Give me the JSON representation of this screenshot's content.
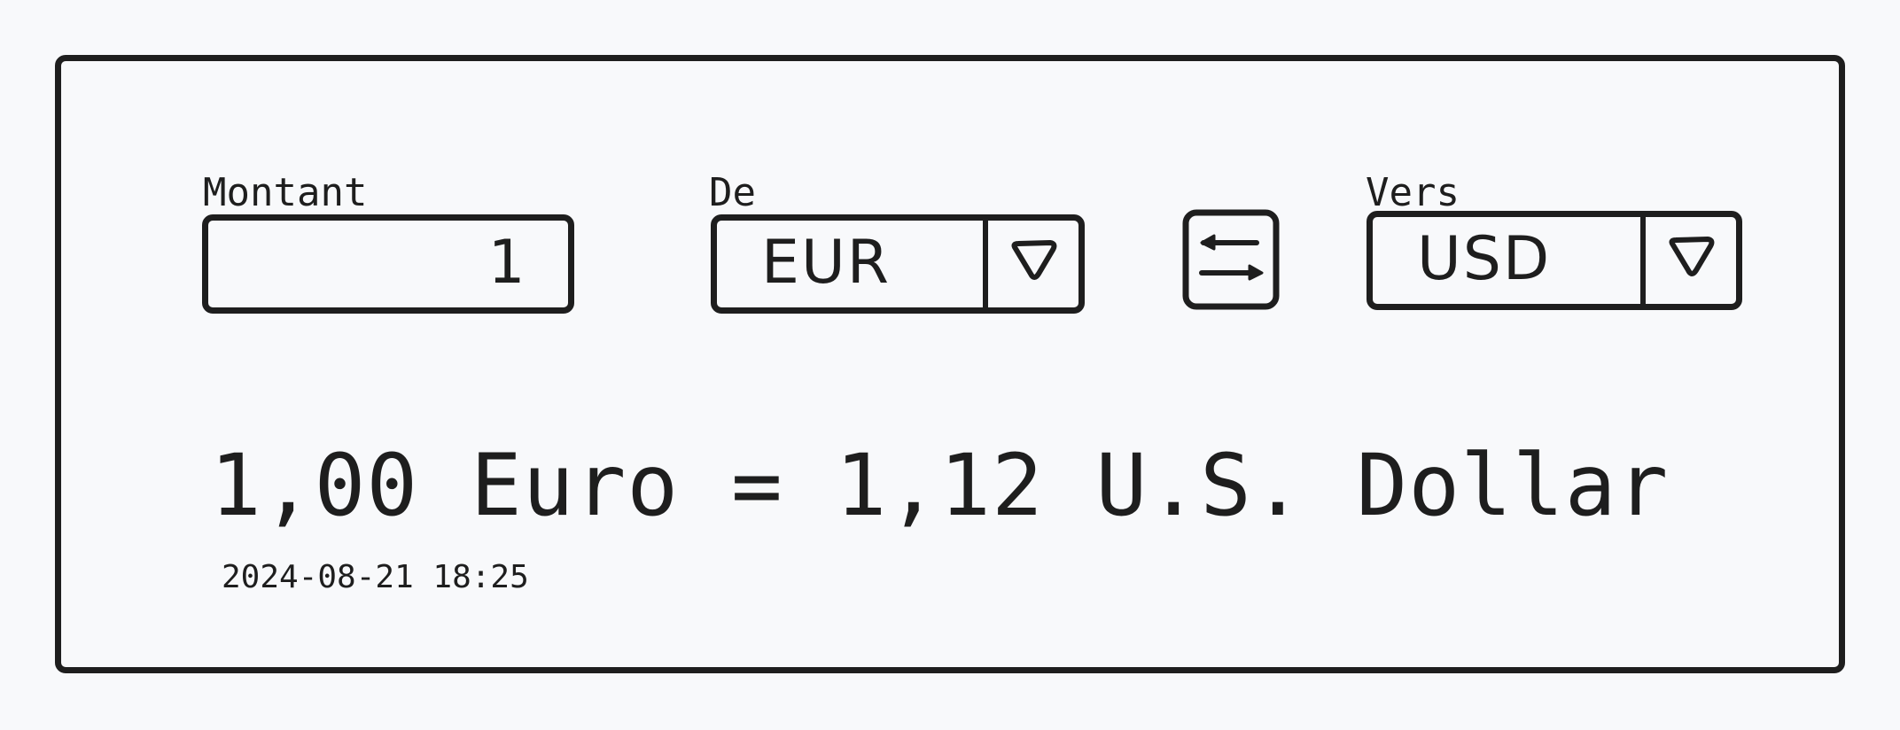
{
  "converter": {
    "amount": {
      "label": "Montant",
      "value": "1"
    },
    "from": {
      "label": "De",
      "value": "EUR"
    },
    "to": {
      "label": "Vers",
      "value": "USD"
    },
    "swap_icon": "swap-arrows-icon",
    "dropdown_icon": "triangle-down-icon",
    "result_text": "1,00 Euro = 1,12 U.S. Dollar",
    "timestamp": "2024-08-21 18:25"
  },
  "colors": {
    "ink": "#1e1e1e",
    "background": "#f8f9fb"
  }
}
